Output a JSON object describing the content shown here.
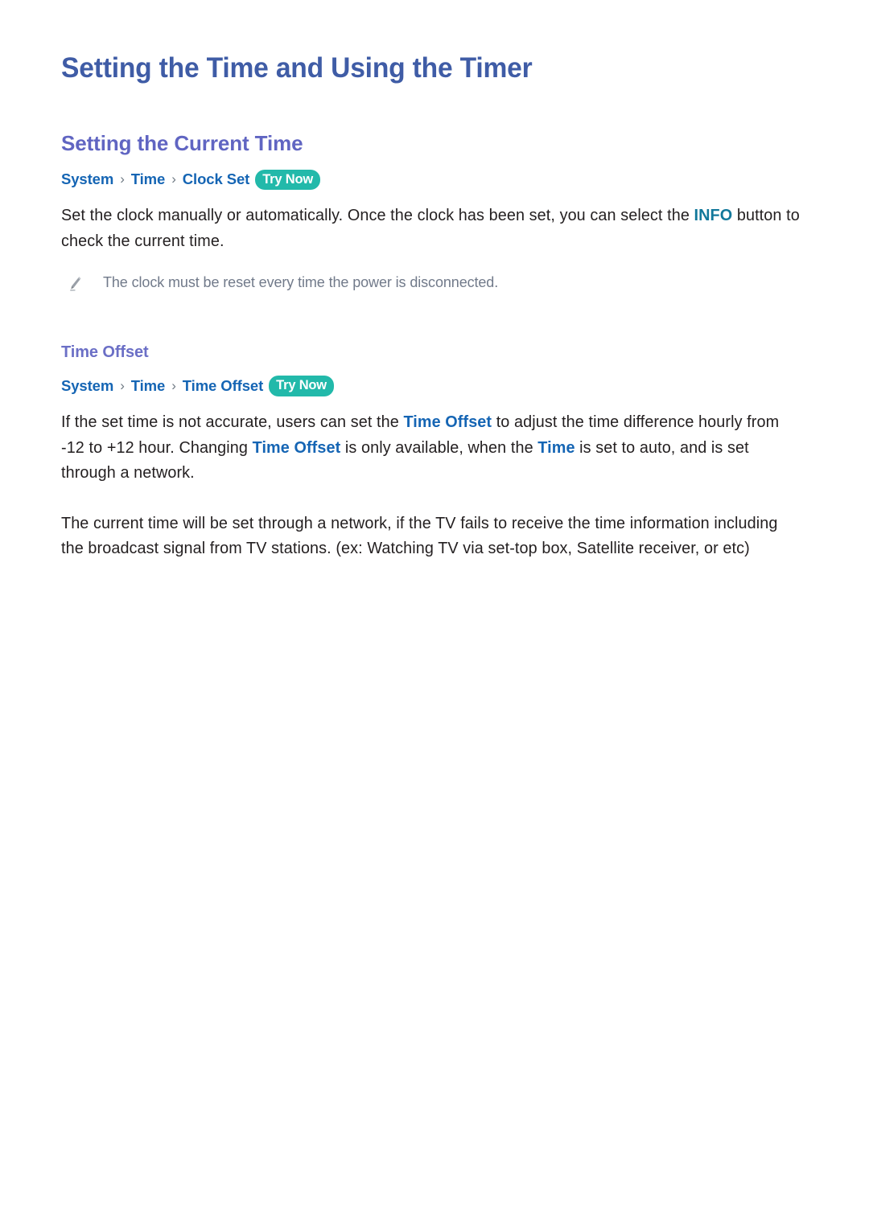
{
  "document": {
    "title": "Setting the Time and Using the Timer",
    "background_color": "#ffffff"
  },
  "colors": {
    "title": "#3f5ca6",
    "heading": "#6065c2",
    "breadcrumb": "#1565b4",
    "try_now_pill": "#22b9aa",
    "try_now_text": "#ffffff",
    "body": "#231f20",
    "note": "#717a8a",
    "keyword": "#1565b4",
    "info_keyword": "#12789b"
  },
  "sections": [
    {
      "heading": "Setting the Current Time",
      "breadcrumb": {
        "items": [
          "System",
          "Time",
          "Clock Set"
        ],
        "separator": "›",
        "action_label": "Try Now"
      },
      "paragraph": {
        "part1": "Set the clock manually or automatically. Once the clock has been set, you can select the ",
        "keyword": "INFO",
        "part2": " button to check the current time."
      },
      "note": {
        "icon": "pencil-icon",
        "text": "The clock must be reset every time the power is disconnected."
      }
    },
    {
      "heading": "Time Offset",
      "breadcrumb": {
        "items": [
          "System",
          "Time",
          "Time Offset"
        ],
        "separator": "›",
        "action_label": "Try Now"
      },
      "paragraph_1": {
        "p1": "If the set time is not accurate, users can set the ",
        "kw1": "Time Offset",
        "p2": " to adjust the time difference hourly from -12 to +12 hour. Changing ",
        "kw2": "Time Offset",
        "p3": " is only available, when the ",
        "kw3": "Time",
        "p4": " is set to auto, and is set through a network."
      },
      "paragraph_2": "The current time will be set through a network, if the TV fails to receive the time information including the broadcast signal from TV stations. (ex: Watching TV via set-top box, Satellite receiver, or etc)"
    }
  ]
}
